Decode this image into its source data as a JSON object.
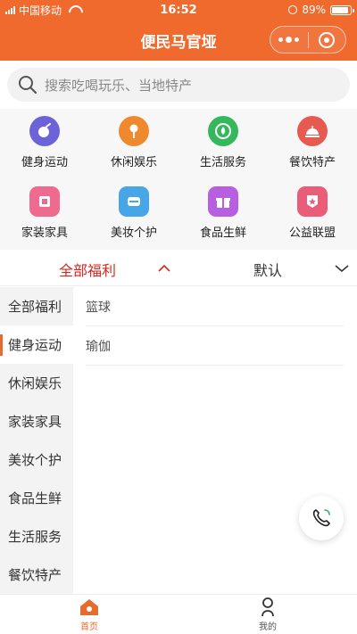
{
  "status_bar": {
    "carrier": "中国移动",
    "time": "16:52",
    "battery": "89%",
    "battery_level": 0.89
  },
  "navbar": {
    "title": "便民马官垭"
  },
  "search": {
    "placeholder": "搜索吃喝玩乐、当地特产"
  },
  "categories": [
    {
      "label": "健身运动",
      "icon": "fitness-icon",
      "color": "#6c63d9"
    },
    {
      "label": "休闲娱乐",
      "icon": "microphone-icon",
      "color": "#f0892d"
    },
    {
      "label": "生活服务",
      "icon": "service-drop-icon",
      "color": "#35b85b"
    },
    {
      "label": "餐饮特产",
      "icon": "dining-cloche-icon",
      "color": "#e75a4f"
    },
    {
      "label": "家装家具",
      "icon": "furniture-icon",
      "color": "#ef6a8f"
    },
    {
      "label": "美妆个护",
      "icon": "makeup-icon",
      "color": "#46a6e8"
    },
    {
      "label": "食品生鲜",
      "icon": "gift-icon",
      "color": "#b85ee0"
    },
    {
      "label": "公益联盟",
      "icon": "charity-badge-icon",
      "color": "#ea5d78"
    }
  ],
  "filters": {
    "category": "全部福利",
    "sort": "默认"
  },
  "sidebar": {
    "items": [
      "全部福利",
      "健身运动",
      "休闲娱乐",
      "家装家具",
      "美妆个护",
      "食品生鲜",
      "生活服务",
      "餐饮特产"
    ],
    "active_index": 1
  },
  "content": {
    "items": [
      "篮球",
      "瑜伽"
    ]
  },
  "tabbar": {
    "home": "首页",
    "mine": "我的"
  },
  "colors": {
    "brand": "#f06a2e",
    "accent_red": "#d8261e"
  }
}
